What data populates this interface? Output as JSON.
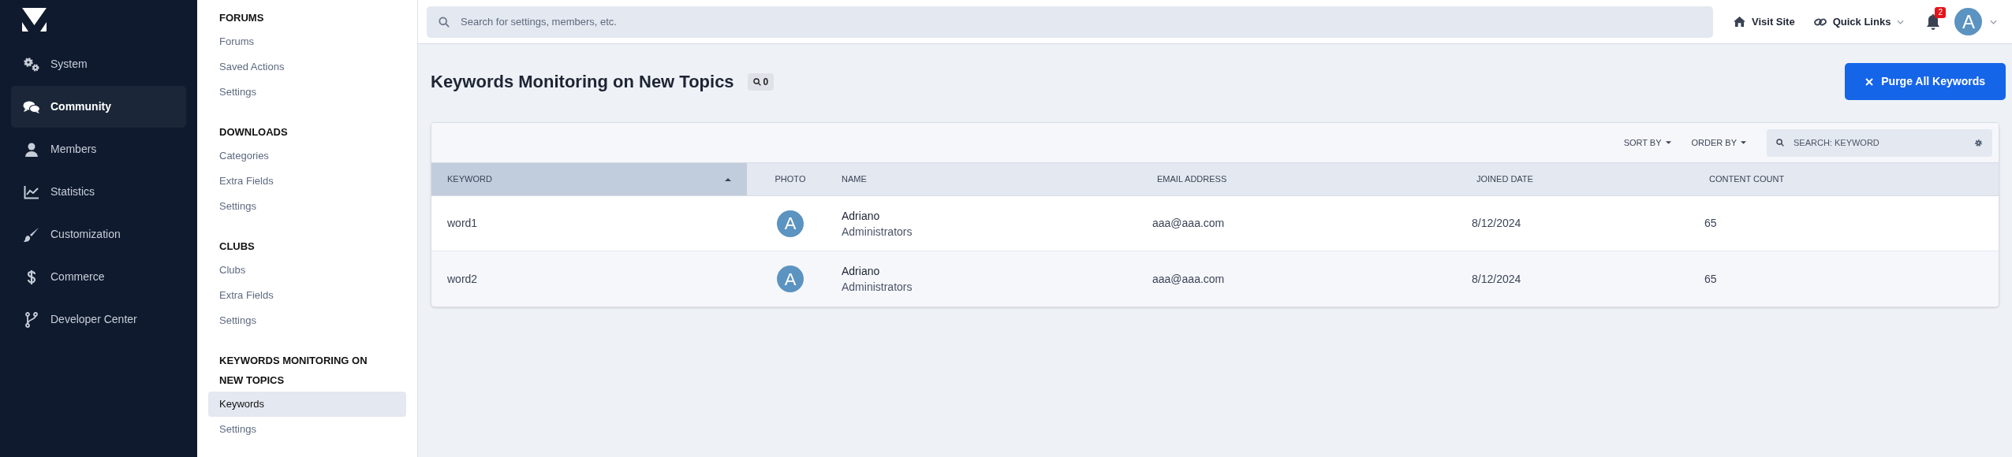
{
  "nav": [
    {
      "label": "System",
      "selected": false
    },
    {
      "label": "Community",
      "selected": true
    },
    {
      "label": "Members",
      "selected": false
    },
    {
      "label": "Statistics",
      "selected": false
    },
    {
      "label": "Customization",
      "selected": false
    },
    {
      "label": "Commerce",
      "selected": false
    },
    {
      "label": "Developer Center",
      "selected": false
    }
  ],
  "subnav": [
    {
      "heading": "FORUMS",
      "items": [
        {
          "label": "Forums",
          "selected": false
        },
        {
          "label": "Saved Actions",
          "selected": false
        },
        {
          "label": "Settings",
          "selected": false
        }
      ]
    },
    {
      "heading": "DOWNLOADS",
      "items": [
        {
          "label": "Categories",
          "selected": false
        },
        {
          "label": "Extra Fields",
          "selected": false
        },
        {
          "label": "Settings",
          "selected": false
        }
      ]
    },
    {
      "heading": "CLUBS",
      "items": [
        {
          "label": "Clubs",
          "selected": false
        },
        {
          "label": "Extra Fields",
          "selected": false
        },
        {
          "label": "Settings",
          "selected": false
        }
      ]
    },
    {
      "heading": "KEYWORDS MONITORING ON NEW TOPICS",
      "items": [
        {
          "label": "Keywords",
          "selected": true
        },
        {
          "label": "Settings",
          "selected": false
        }
      ]
    }
  ],
  "topbar": {
    "search": {
      "placeholder": "Search for settings, members, etc."
    },
    "visit_site": "Visit Site",
    "quick_links": "Quick Links",
    "notifications": "2",
    "avatar": "A"
  },
  "page": {
    "title": "Keywords Monitoring on New Topics",
    "count": "0",
    "purge_button": "Purge All Keywords"
  },
  "table": {
    "sort_by": "SORT BY",
    "order_by": "ORDER BY",
    "search": {
      "placeholder": "SEARCH: KEYWORD"
    },
    "columns": [
      {
        "label": "KEYWORD",
        "sorted": true
      },
      {
        "label": "PHOTO",
        "sorted": false
      },
      {
        "label": "NAME",
        "sorted": false
      },
      {
        "label": "EMAIL ADDRESS",
        "sorted": false
      },
      {
        "label": "JOINED DATE",
        "sorted": false
      },
      {
        "label": "CONTENT COUNT",
        "sorted": false
      }
    ],
    "rows": [
      {
        "keyword": "word1",
        "avatar": "A",
        "name": "Adriano",
        "group": "Administrators",
        "email": "aaa@aaa.com",
        "joined": "8/12/2024",
        "count": "65"
      },
      {
        "keyword": "word2",
        "avatar": "A",
        "name": "Adriano",
        "group": "Administrators",
        "email": "aaa@aaa.com",
        "joined": "8/12/2024",
        "count": "65"
      }
    ]
  }
}
